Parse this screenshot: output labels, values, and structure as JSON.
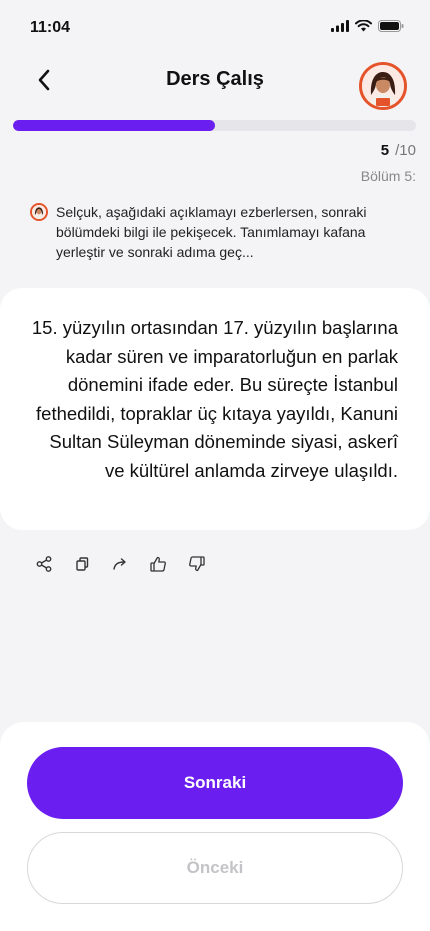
{
  "status_bar": {
    "time": "11:04",
    "icons": [
      "signal-icon",
      "wifi-icon",
      "battery-icon"
    ]
  },
  "header": {
    "title": "Ders Çalış",
    "back_icon": "chevron-left-icon",
    "avatar": "tutor-avatar"
  },
  "progress": {
    "current": "5",
    "total": "/10",
    "fraction": 0.5,
    "section_label": "Bölüm 5:"
  },
  "instruction": {
    "text": "Selçuk, aşağıdaki açıklamayı ezberlersen, sonraki bölümdeki bilgi ile pekişecek. Tanımlamayı kafana yerleştir ve sonraki adıma geç..."
  },
  "card": {
    "text": "15. yüzyılın ortasından 17. yüzyılın başlarına kadar süren ve imparatorluğun en parlak dönemini ifade eder. Bu süreçte İstanbul fethedildi, topraklar üç kıtaya yayıldı, Kanuni Sultan Süleyman döneminde siyasi, askerî ve kültürel anlamda zirveye ulaşıldı."
  },
  "actions": [
    "share-icon",
    "copy-icon",
    "forward-icon",
    "thumbs-up-icon",
    "thumbs-down-icon"
  ],
  "buttons": {
    "next_label": "Sonraki",
    "prev_label": "Önceki"
  },
  "colors": {
    "accent": "#6a1ff0",
    "avatar_ring": "#e5532a",
    "track": "#e6e6ea"
  }
}
